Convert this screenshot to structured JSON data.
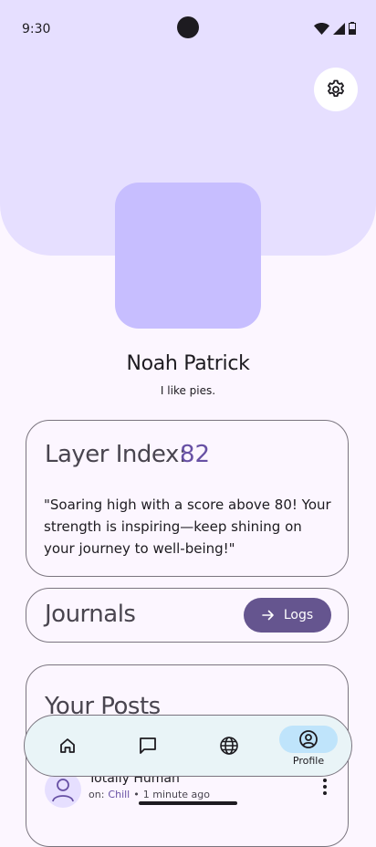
{
  "status_bar": {
    "time": "9:30"
  },
  "profile": {
    "name": "Noah Patrick",
    "bio": "I like pies."
  },
  "layer_index": {
    "title": "Layer Index:",
    "value": "82",
    "quote": "\"Soaring high with a score above 80! Your strength is inspiring—keep shining on your journey to well-being!\""
  },
  "journals": {
    "title": "Journals",
    "logs_label": "Logs"
  },
  "posts": {
    "title": "Your Posts",
    "items": [
      {
        "author": "Totally Human",
        "on_label": "on:",
        "channel": "Chill",
        "time": "1 minute ago"
      }
    ]
  },
  "bottom_nav": {
    "items": [
      {
        "icon": "home-icon"
      },
      {
        "icon": "chat-icon"
      },
      {
        "icon": "globe-icon"
      },
      {
        "icon": "profile-icon",
        "label": "Profile",
        "active": true
      }
    ]
  },
  "colors": {
    "header": "#e6dfff",
    "avatar": "#c7beff",
    "accent": "#6750a4",
    "logs_button": "#65558f",
    "nav_background": "#e9f4f7",
    "nav_active": "#bfe4fb"
  }
}
